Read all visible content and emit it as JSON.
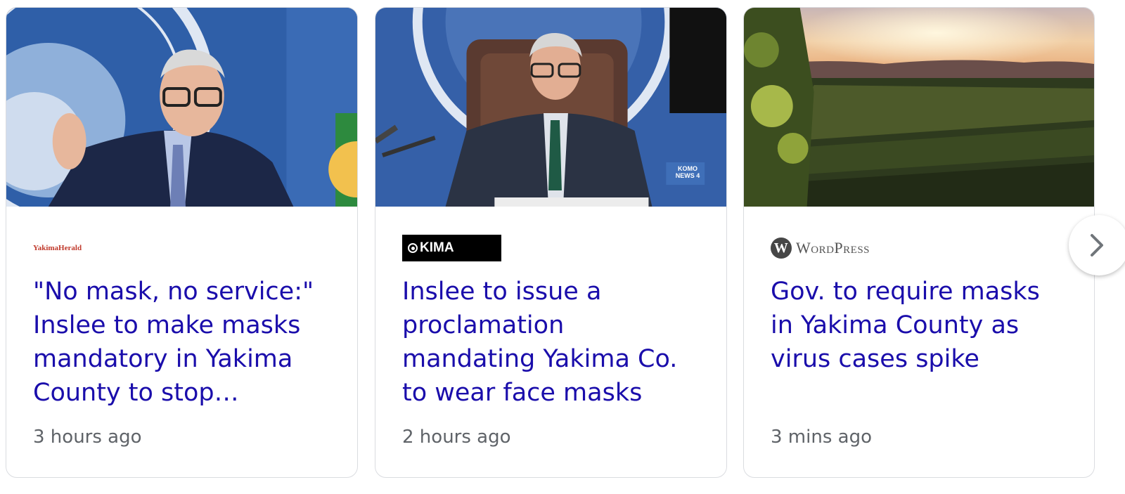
{
  "cards": [
    {
      "source": "YakimaHerald",
      "headline": "\"No mask, no service:\" Inslee to make masks mandatory in Yakima County to stop…",
      "time": "3 hours ago"
    },
    {
      "source": "KIMA",
      "headline": "Inslee to issue a proclamation mandating Yakima Co. to wear face masks",
      "time": "2 hours ago"
    },
    {
      "source": "WordPress",
      "source_logo_letter": "W",
      "headline": "Gov. to require masks in Yakima County as virus cases spike",
      "time": "3 mins ago"
    }
  ],
  "thumb2_overlay": "KOMO NEWS 4",
  "colors": {
    "headline": "#1a0dab",
    "time": "#5f6368",
    "seal_blue": "#2f5fa8"
  },
  "icons": {
    "next": "chevron-right-icon"
  }
}
